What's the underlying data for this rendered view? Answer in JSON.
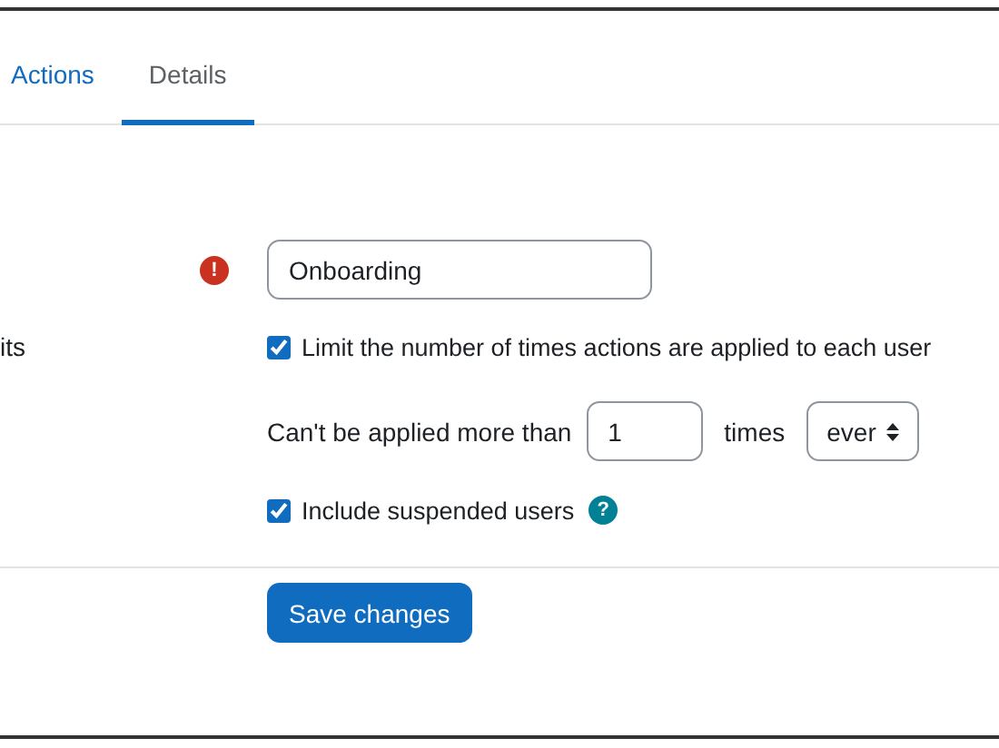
{
  "tabs": [
    {
      "label": "Actions",
      "selected": false
    },
    {
      "label": "Details",
      "selected": true
    }
  ],
  "form": {
    "name_field": {
      "value": "Onboarding",
      "error_mark": "!"
    },
    "limit_label": "its",
    "limit_checkbox": {
      "label": "Limit the number of times actions are applied to each user",
      "checked": true
    },
    "limit_row": {
      "prefix": "Can't be applied more than",
      "count": "1",
      "unit": "times",
      "period": "ever"
    },
    "suspended_checkbox": {
      "label": "Include suspended users",
      "checked": true,
      "help_mark": "?"
    }
  },
  "buttons": [
    "Save changes"
  ]
}
